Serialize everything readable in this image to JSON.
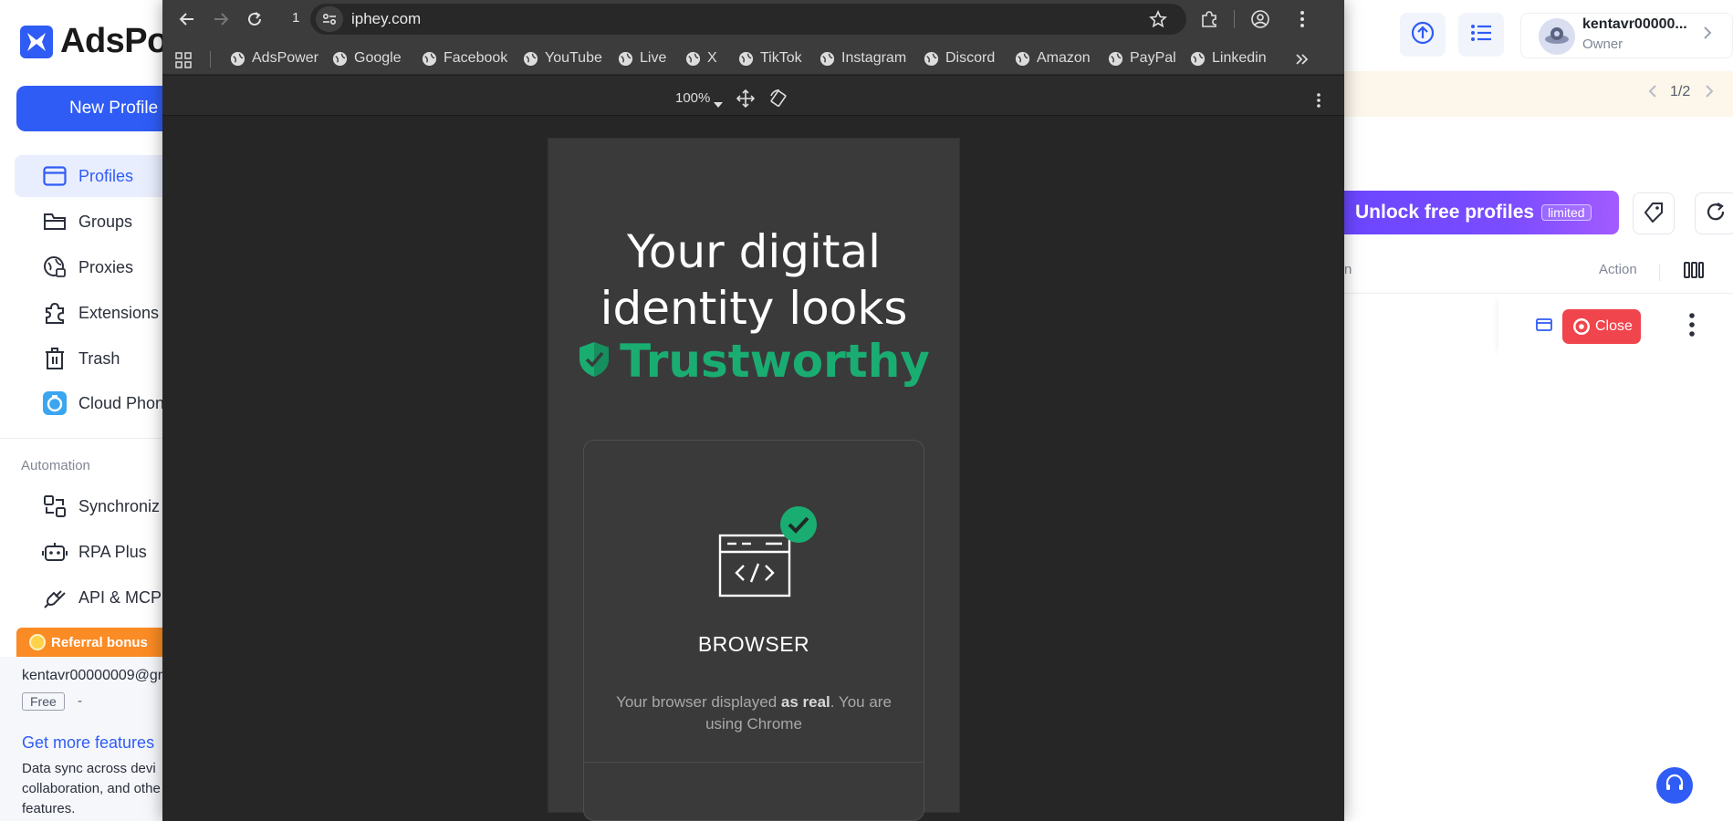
{
  "app": {
    "logo_text": "AdsPo",
    "new_profile_label": "New Profile",
    "nav": [
      {
        "label": "Profiles",
        "icon": "profiles-icon",
        "active": true
      },
      {
        "label": "Groups",
        "icon": "folder-icon"
      },
      {
        "label": "Proxies",
        "icon": "globe-lock-icon"
      },
      {
        "label": "Extensions",
        "icon": "puzzle-icon"
      },
      {
        "label": "Trash",
        "icon": "trash-icon"
      },
      {
        "label": "Cloud Phon",
        "icon": "cloud-phone-icon"
      }
    ],
    "automation_label": "Automation",
    "automation_nav": [
      {
        "label": "Synchroniz",
        "icon": "sync-icon"
      },
      {
        "label": "RPA Plus",
        "icon": "robot-icon"
      },
      {
        "label": "API & MCP",
        "icon": "plug-icon"
      }
    ],
    "referral_label": "Referral bonus",
    "account_email": "kentavr00000009@gr",
    "plan": "Free",
    "plan_suffix": "-",
    "more_features": "Get more features",
    "more_desc": "Data sync across devi collaboration, and othe features."
  },
  "right_panel": {
    "username": "kentavr00000...",
    "role": "Owner",
    "pager": "1/2",
    "promo_text": "Unlock free profiles",
    "promo_badge": "limited",
    "col_partial": "n",
    "col_action": "Action",
    "close_button": "Close",
    "accent": "#2f5cf5",
    "close_color": "#f0454c"
  },
  "browser": {
    "tab_count": "1",
    "url": "iphey.com",
    "bookmarks": [
      "AdsPower",
      "Google",
      "Facebook",
      "YouTube",
      "Live",
      "X",
      "TikTok",
      "Instagram",
      "Discord",
      "Amazon",
      "PayPal",
      "Linkedin"
    ],
    "zoom": "100%"
  },
  "page": {
    "headline_line1": "Your digital",
    "headline_line2": "identity looks",
    "verdict": "Trustworthy",
    "verdict_color": "#1aad72",
    "card_title": "BROWSER",
    "card_desc_1": "Your browser displayed ",
    "card_desc_bold": "as real",
    "card_desc_2": ". You are using Chrome"
  }
}
